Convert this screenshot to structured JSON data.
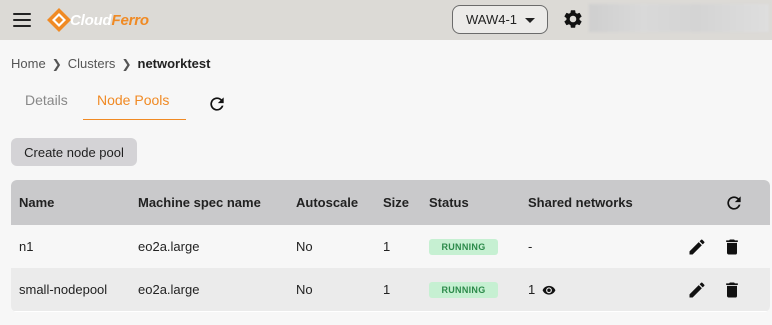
{
  "header": {
    "logo_prefix": "Cloud",
    "logo_suffix": "Ferro",
    "region": "WAW4-1",
    "brand_color": "#f08a24"
  },
  "breadcrumb": {
    "items": [
      "Home",
      "Clusters"
    ],
    "current": "networktest"
  },
  "tabs": [
    {
      "label": "Details",
      "active": false
    },
    {
      "label": "Node Pools",
      "active": true
    }
  ],
  "actions": {
    "create_label": "Create node pool"
  },
  "table": {
    "columns": [
      "Name",
      "Machine spec name",
      "Autoscale",
      "Size",
      "Status",
      "Shared networks"
    ],
    "rows": [
      {
        "name": "n1",
        "spec": "eo2a.large",
        "autoscale": "No",
        "size": "1",
        "status": "RUNNING",
        "shared": "-"
      },
      {
        "name": "small-nodepool",
        "spec": "eo2a.large",
        "autoscale": "No",
        "size": "1",
        "status": "RUNNING",
        "shared": "1"
      }
    ]
  },
  "icons": {
    "menu": "menu-icon",
    "settings": "gear-icon",
    "refresh": "refresh-icon",
    "edit": "pencil-icon",
    "delete": "trash-icon",
    "view": "eye-icon"
  }
}
